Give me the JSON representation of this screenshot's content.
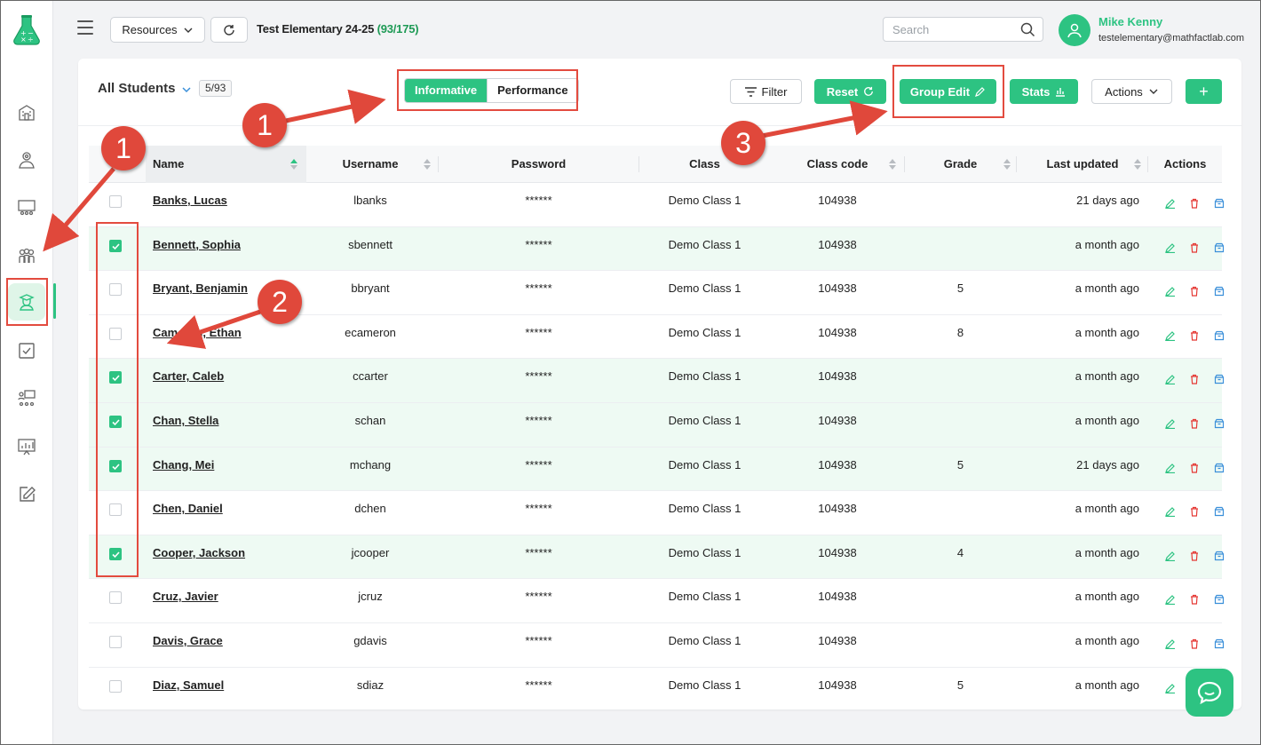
{
  "header": {
    "resources_label": "Resources",
    "school_name": "Test Elementary 24-25",
    "school_count": "(93/175)",
    "search_placeholder": "Search",
    "user_name": "Mike Kenny",
    "user_email": "testelementary@mathfactlab.com"
  },
  "toolbar": {
    "title": "All Students",
    "count": "5/93",
    "tabs": [
      {
        "label": "Informative",
        "active": true
      },
      {
        "label": "Performance",
        "active": false
      }
    ],
    "filter_label": "Filter",
    "reset_label": "Reset",
    "group_edit_label": "Group Edit",
    "stats_label": "Stats",
    "actions_label": "Actions",
    "add_label": "+"
  },
  "table": {
    "columns": [
      "Name",
      "Username",
      "Password",
      "Class",
      "Class code",
      "Grade",
      "Last updated",
      "Actions"
    ],
    "rows": [
      {
        "selected": false,
        "name": "Banks, Lucas",
        "username": "lbanks",
        "password": "******",
        "class": "Demo Class 1",
        "code": "104938",
        "grade": "",
        "updated": "21 days ago"
      },
      {
        "selected": true,
        "name": "Bennett, Sophia",
        "username": "sbennett",
        "password": "******",
        "class": "Demo Class 1",
        "code": "104938",
        "grade": "",
        "updated": "a month ago"
      },
      {
        "selected": false,
        "name": "Bryant, Benjamin",
        "username": "bbryant",
        "password": "******",
        "class": "Demo Class 1",
        "code": "104938",
        "grade": "5",
        "updated": "a month ago"
      },
      {
        "selected": false,
        "name": "Cameron, Ethan",
        "username": "ecameron",
        "password": "******",
        "class": "Demo Class 1",
        "code": "104938",
        "grade": "8",
        "updated": "a month ago"
      },
      {
        "selected": true,
        "name": "Carter, Caleb",
        "username": "ccarter",
        "password": "******",
        "class": "Demo Class 1",
        "code": "104938",
        "grade": "",
        "updated": "a month ago"
      },
      {
        "selected": true,
        "name": "Chan, Stella",
        "username": "schan",
        "password": "******",
        "class": "Demo Class 1",
        "code": "104938",
        "grade": "",
        "updated": "a month ago"
      },
      {
        "selected": true,
        "name": "Chang, Mei",
        "username": "mchang",
        "password": "******",
        "class": "Demo Class 1",
        "code": "104938",
        "grade": "5",
        "updated": "21 days ago"
      },
      {
        "selected": false,
        "name": "Chen, Daniel",
        "username": "dchen",
        "password": "******",
        "class": "Demo Class 1",
        "code": "104938",
        "grade": "",
        "updated": "a month ago"
      },
      {
        "selected": true,
        "name": "Cooper, Jackson",
        "username": "jcooper",
        "password": "******",
        "class": "Demo Class 1",
        "code": "104938",
        "grade": "4",
        "updated": "a month ago"
      },
      {
        "selected": false,
        "name": "Cruz, Javier",
        "username": "jcruz",
        "password": "******",
        "class": "Demo Class 1",
        "code": "104938",
        "grade": "",
        "updated": "a month ago"
      },
      {
        "selected": false,
        "name": "Davis, Grace",
        "username": "gdavis",
        "password": "******",
        "class": "Demo Class 1",
        "code": "104938",
        "grade": "",
        "updated": "a month ago"
      },
      {
        "selected": false,
        "name": "Diaz, Samuel",
        "username": "sdiaz",
        "password": "******",
        "class": "Demo Class 1",
        "code": "104938",
        "grade": "5",
        "updated": "a month ago"
      }
    ]
  },
  "annotations": {
    "badges": [
      "1",
      "1",
      "2",
      "3"
    ]
  },
  "colors": {
    "accent": "#2dc382",
    "annotation_red": "#e0483b",
    "selected_row": "#eefaf3"
  }
}
